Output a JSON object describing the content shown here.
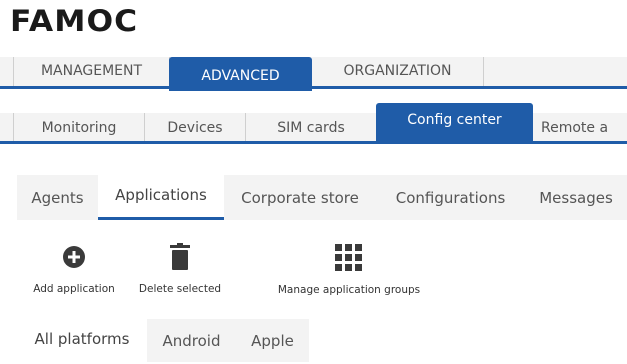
{
  "brand": {
    "logo_text": "FAMOC"
  },
  "main_tabs": [
    "MANAGEMENT",
    "ADVANCED",
    "ORGANIZATION"
  ],
  "main_tabs_active": "ADVANCED",
  "sub_tabs": [
    "Monitoring",
    "Devices",
    "SIM cards",
    "Config center",
    "Remote a"
  ],
  "sub_tabs_active": "Config center",
  "section_tabs": [
    "Agents",
    "Applications",
    "Corporate store",
    "Configurations",
    "Messages"
  ],
  "section_tabs_active": "Applications",
  "toolbar": {
    "add": {
      "label": "Add application",
      "icon": "plus-circle-icon"
    },
    "delete": {
      "label": "Delete selected",
      "icon": "trash-icon"
    },
    "groups": {
      "label": "Manage application groups",
      "icon": "grid-icon"
    }
  },
  "platform_tabs": [
    "All platforms",
    "Android",
    "Apple"
  ],
  "platform_tabs_active": "All platforms",
  "colors": {
    "accent": "#1f5ca8",
    "tab_bg": "#f3f3f3",
    "icon": "#3a3a3a"
  }
}
